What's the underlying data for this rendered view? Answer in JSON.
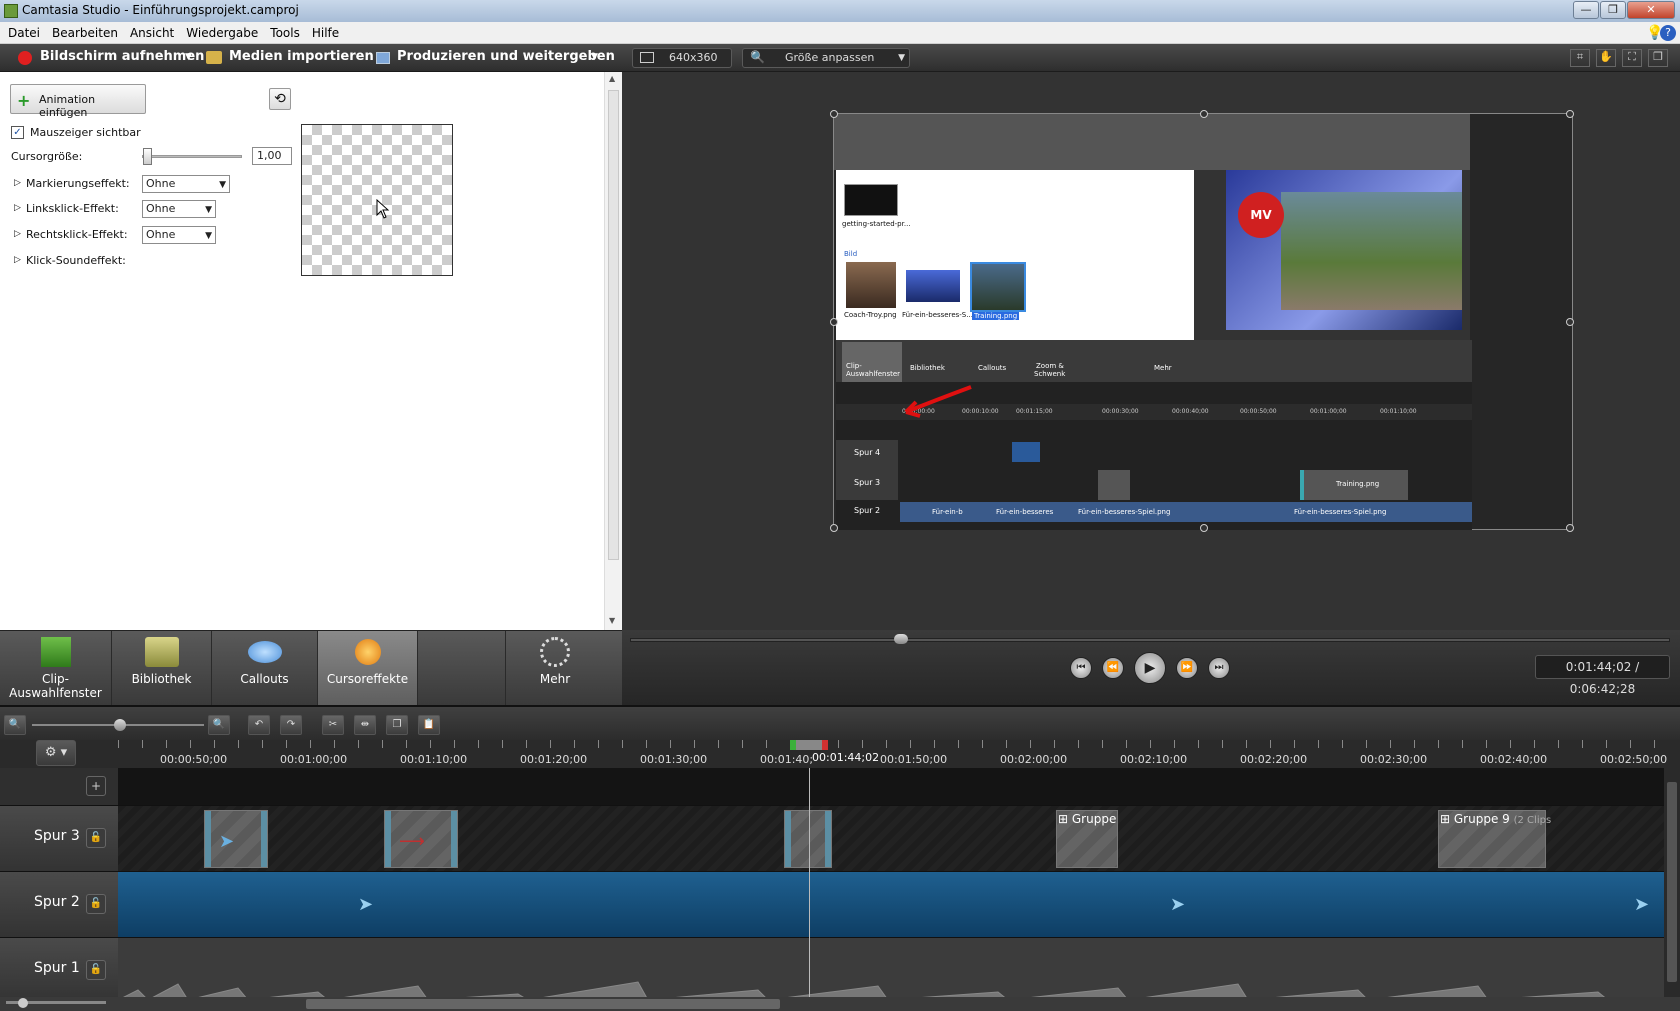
{
  "window": {
    "title": "Camtasia Studio - Einführungsprojekt.camproj"
  },
  "menu": [
    "Datei",
    "Bearbeiten",
    "Ansicht",
    "Wiedergabe",
    "Tools",
    "Hilfe"
  ],
  "toolbar": {
    "record": "Bildschirm aufnehmen",
    "import": "Medien importieren",
    "produce": "Produzieren und weitergeben"
  },
  "panel": {
    "animation_button": "Animation einfügen",
    "cursor_visible": "Mauszeiger sichtbar",
    "cursor_size_label": "Cursorgröße:",
    "cursor_size_value": "1,00",
    "highlight_label": "Markierungseffekt:",
    "highlight_value": "Ohne",
    "leftclick_label": "Linksklick-Effekt:",
    "leftclick_value": "Ohne",
    "rightclick_label": "Rechtsklick-Effekt:",
    "rightclick_value": "Ohne",
    "clicksound_label": "Klick-Soundeffekt:"
  },
  "tabs": [
    {
      "line1": "Clip-",
      "line2": "Auswahlfenster"
    },
    {
      "line1": "Bibliothek"
    },
    {
      "line1": "Callouts"
    },
    {
      "line1": "Cursoreffekte"
    },
    {
      "line1": "Mehr"
    }
  ],
  "preview": {
    "resolution": "640x360",
    "zoom": "Größe anpassen",
    "time": "0:01:44;02 / 0:06:42;28"
  },
  "inner": {
    "media1": "getting-started-pr...",
    "section": "Bild",
    "thumb1": "Coach-Troy.png",
    "thumb2": "Für-ein-besseres-S...",
    "thumb3": "Training.png",
    "tab1a": "Clip-",
    "tab1b": "Auswahlfenster",
    "tab2": "Bibliothek",
    "tab3": "Callouts",
    "tab4a": "Zoom &",
    "tab4b": "Schwenk",
    "tab5": "Mehr",
    "track4": "Spur 4",
    "track3": "Spur 3",
    "track2": "Spur 2",
    "clip_training": "Training.png",
    "clip_a": "Für-ein-b",
    "clip_b": "Für-ein-besseres",
    "clip_c": "Für-ein-besseres-Spiel.png",
    "clip_d": "Für-ein-besseres-Spiel.png",
    "ticks": [
      "0:00:00:00",
      "00:00:10:00",
      "00:01:15;00",
      "00:00:30;00",
      "00:00:40;00",
      "00:00:50;00",
      "00:01:00;00",
      "00:01:10;00"
    ]
  },
  "ruler": {
    "ticks": [
      "00:00:50;00",
      "00:01:00;00",
      "00:01:10;00",
      "00:01:20;00",
      "00:01:30;00",
      "00:01:40;00",
      "00:01:50;00",
      "00:02:00;00",
      "00:02:10;00",
      "00:02:20;00",
      "00:02:30;00",
      "00:02:40;00",
      "00:02:50;00"
    ],
    "playhead": "00:01:44;02"
  },
  "tracks": {
    "t3": "Spur 3",
    "t2": "Spur 2",
    "t1": "Spur 1",
    "group1": "Gruppe",
    "group2": "Gruppe 9",
    "group2_sub": "(2 Clips"
  }
}
